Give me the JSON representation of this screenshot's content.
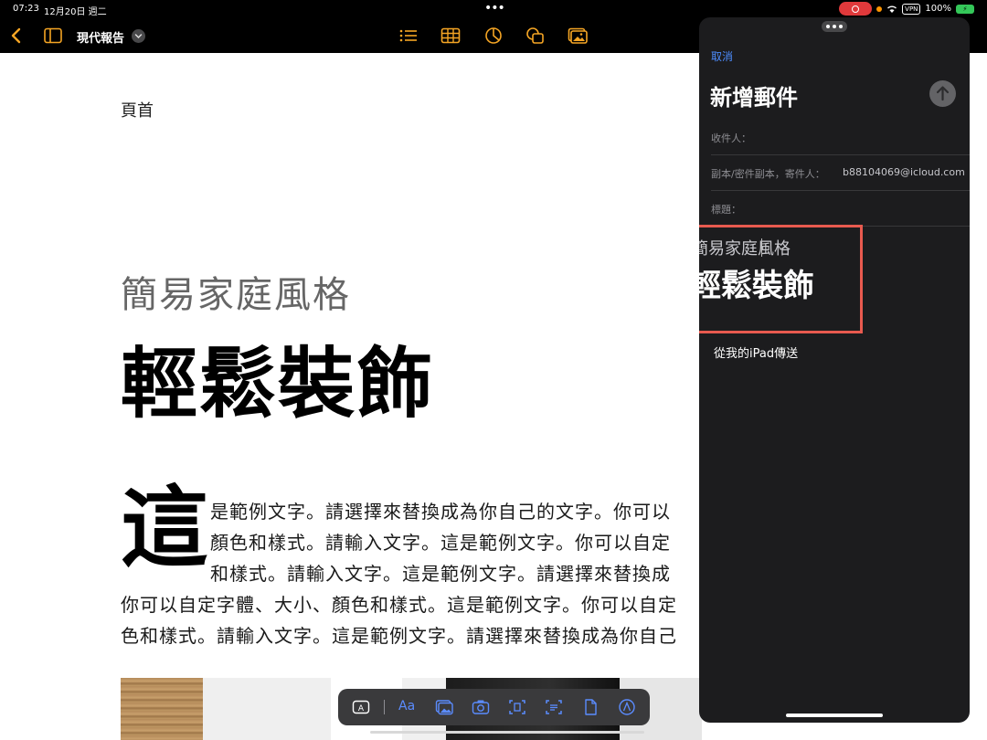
{
  "status_bar": {
    "time": "07:23",
    "date": "12月20日 週二",
    "vpn_label": "VPN",
    "battery_text": "100%"
  },
  "toolbar": {
    "document_name": "現代報告",
    "icons": [
      "chevron-left-icon",
      "sidebar-icon",
      "chevron-down-icon",
      "list-icon",
      "table-icon",
      "chart-icon",
      "shape-icon",
      "media-icon"
    ]
  },
  "document": {
    "header_text": "頁首",
    "subtitle": "簡易家庭風格",
    "title": "輕鬆裝飾",
    "drop_cap": "這",
    "paragraph_lines": [
      "是範例文字。請選擇來替換成為你自己的文字。你可以",
      "顏色和樣式。請輸入文字。這是範例文字。你可以自定",
      "和樣式。請輸入文字。這是範例文字。請選擇來替換成",
      "你可以自定字體、大小、顏色和樣式。這是範例文字。你可以自定",
      "色和樣式。請輸入文字。這是範例文字。請選擇來替換成為你自己"
    ]
  },
  "insert_bar": {
    "text_style_label": "Aa",
    "icons": [
      "text-box-icon",
      "photo-icon",
      "camera-icon",
      "scan-icon",
      "scan-text-icon",
      "document-icon",
      "pencil-circle-icon"
    ]
  },
  "mail": {
    "cancel_label": "取消",
    "title": "新增郵件",
    "to_label": "收件人：",
    "cc_label": "副本/密件副本，寄件人：",
    "from_address": "b88104069@icloud.com",
    "subject_label": "標題：",
    "pasted_subtitle": "簡易家庭風格",
    "pasted_title": "輕鬆裝飾",
    "signature": "從我的iPad傳送"
  },
  "colors": {
    "accent_blue": "#4d8dff",
    "highlight_border": "#e85a4f",
    "toolbar_orange": "#f5a524",
    "mail_background": "#1c1c1e"
  }
}
